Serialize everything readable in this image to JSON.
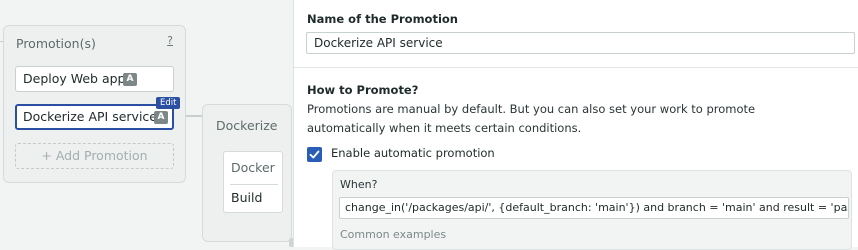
{
  "promotions_panel": {
    "title": "Promotion(s)",
    "help": "?",
    "items": [
      {
        "label": "Deploy Web app",
        "badge": "A"
      },
      {
        "label": "Dockerize API service",
        "badge": "A"
      }
    ],
    "edit_tag": "Edit",
    "add_label": "+ Add Promotion"
  },
  "pipeline": {
    "title": "Dockerize",
    "block_name": "Docker",
    "job_name": "Build"
  },
  "form": {
    "name_label": "Name of the Promotion",
    "name_value": "Dockerize API service",
    "how_label": "How to Promote?",
    "how_description": "Promotions are manual by default. But you can also set your work to promote automatically when it meets certain conditions.",
    "auto_checkbox_label": "Enable automatic promotion",
    "auto_checked": true,
    "when_label": "When?",
    "when_value": "change_in('/packages/api/', {default_branch: 'main'}) and branch = 'main' and result = 'passed'",
    "examples_label": "Common examples"
  },
  "colors": {
    "accent": "#2a4fa3",
    "checkbox": "#2a5db5",
    "badge": "#7d8787"
  }
}
